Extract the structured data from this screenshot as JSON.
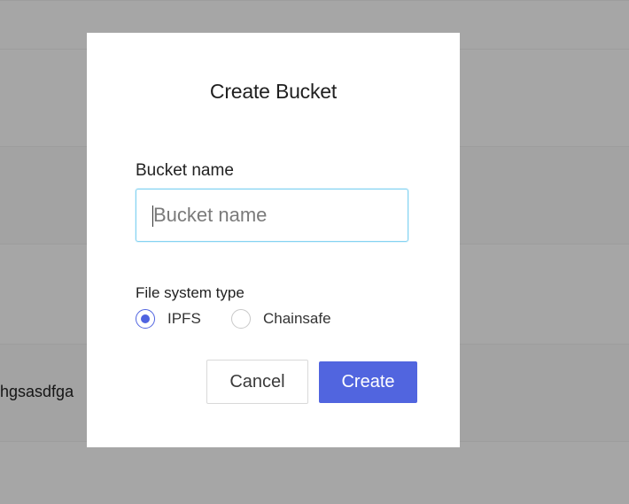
{
  "background": {
    "row_text": "ehgsasdfga"
  },
  "modal": {
    "title": "Create Bucket",
    "bucket_name_label": "Bucket name",
    "bucket_name_placeholder": "Bucket name",
    "bucket_name_value": "",
    "fs_type_label": "File system type",
    "fs_options": [
      {
        "label": "IPFS",
        "selected": true
      },
      {
        "label": "Chainsafe",
        "selected": false
      }
    ],
    "cancel_label": "Cancel",
    "create_label": "Create"
  },
  "colors": {
    "accent": "#5165df",
    "input_focus_border": "#84d3f2",
    "overlay": "rgba(0,0,0,0.35)"
  }
}
